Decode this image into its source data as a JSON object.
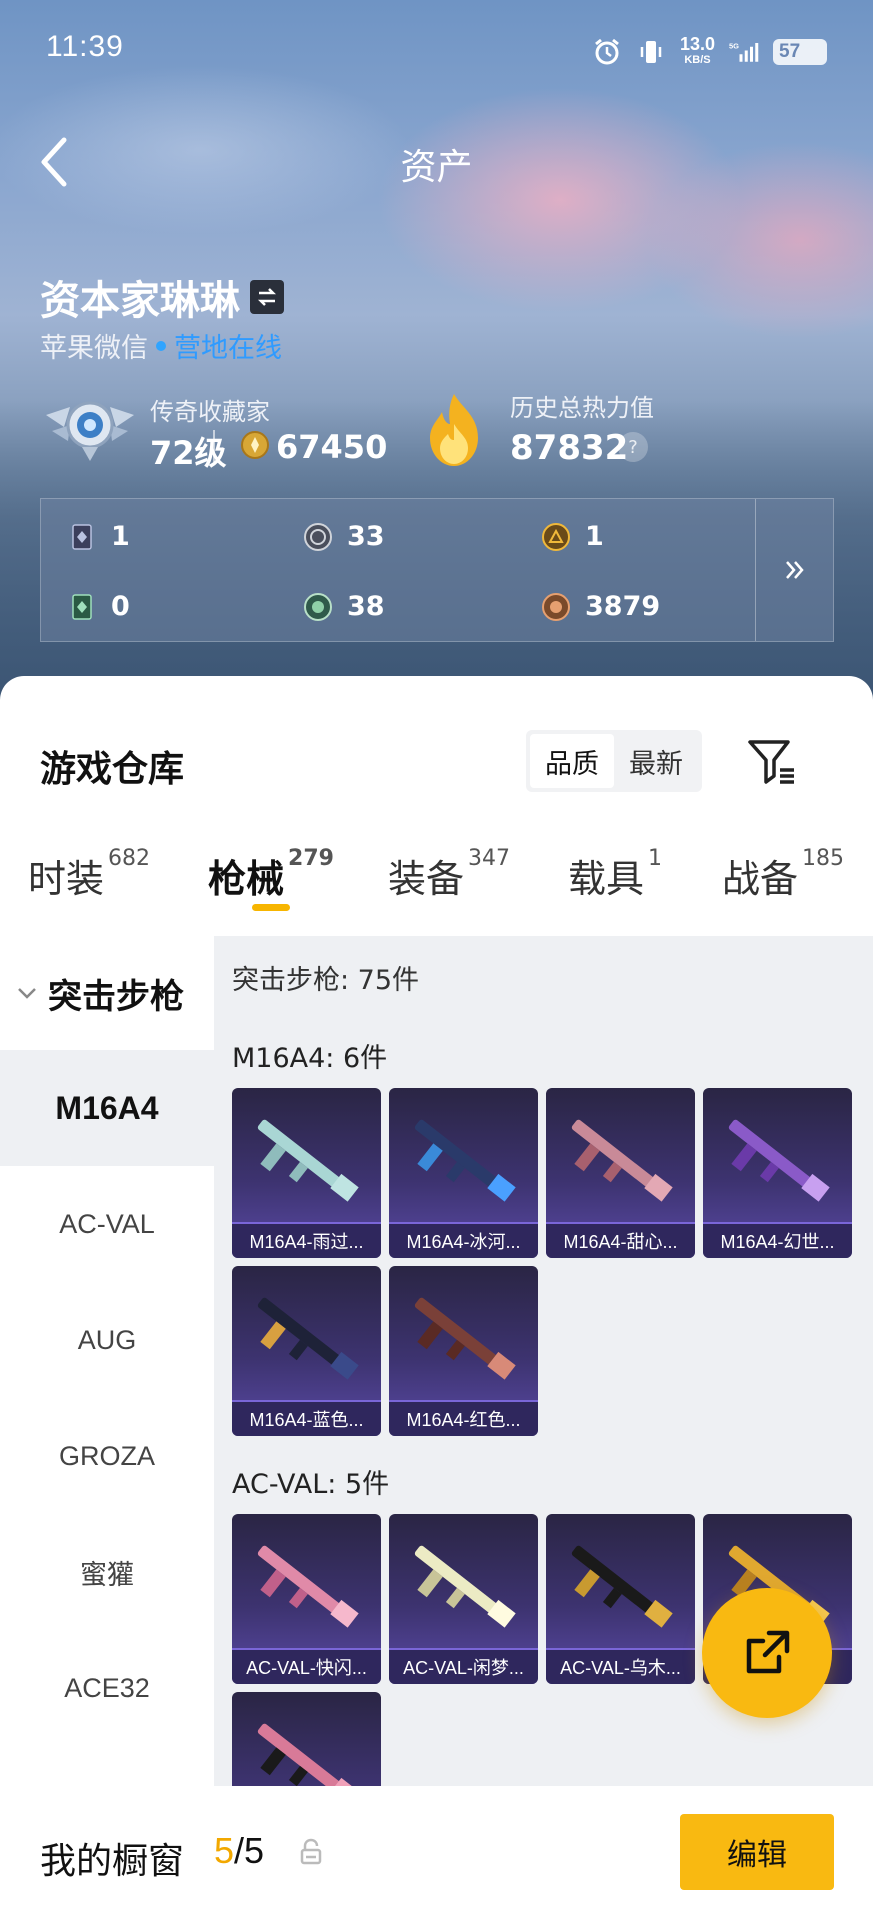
{
  "status": {
    "time": "11:39",
    "net_speed": "13.0",
    "net_unit": "KB/S",
    "battery": "57"
  },
  "header": {
    "title": "资产"
  },
  "player": {
    "name": "资本家琳琳",
    "platform": "苹果微信",
    "online_status": "营地在线",
    "rank_title": "传奇收藏家",
    "level": "72级",
    "coins": "67450",
    "heat_label": "历史总热力值",
    "heat_value": "87832"
  },
  "stats": [
    {
      "icon": "card-icon",
      "value": "1"
    },
    {
      "icon": "silver-coin-icon",
      "value": "33"
    },
    {
      "icon": "gold-coin-icon",
      "value": "1"
    },
    {
      "icon": "green-card-icon",
      "value": "0"
    },
    {
      "icon": "green-coin-icon",
      "value": "38"
    },
    {
      "icon": "bronze-coin-icon",
      "value": "3879"
    }
  ],
  "warehouse": {
    "title": "游戏仓库",
    "sort_options": [
      "品质",
      "最新"
    ],
    "tabs": [
      {
        "label": "时装",
        "count": "682"
      },
      {
        "label": "枪械",
        "count": "279"
      },
      {
        "label": "装备",
        "count": "347"
      },
      {
        "label": "载具",
        "count": "1"
      },
      {
        "label": "战备",
        "count": "185"
      }
    ]
  },
  "sidebar": {
    "category": "突击步枪",
    "items": [
      "M16A4",
      "AC-VAL",
      "AUG",
      "GROZA",
      "蜜獾",
      "ACE32"
    ]
  },
  "content": {
    "category_count": "突击步枪: 75件",
    "groups": [
      {
        "title": "M16A4: 6件",
        "items": [
          "M16A4-雨过...",
          "M16A4-冰河...",
          "M16A4-甜心...",
          "M16A4-幻世...",
          "M16A4-蓝色...",
          "M16A4-红色..."
        ]
      },
      {
        "title": "AC-VAL: 5件",
        "items": [
          "AC-VAL-快闪...",
          "AC-VAL-闲梦...",
          "AC-VAL-乌木...",
          ""
        ]
      }
    ]
  },
  "bottom": {
    "showcase_label": "我的橱窗",
    "showcase_current": "5",
    "showcase_total": "/5",
    "edit_label": "编辑"
  },
  "colors": {
    "accent": "#f9b911",
    "online": "#2f9bff",
    "card_bg": "#3d3370"
  }
}
